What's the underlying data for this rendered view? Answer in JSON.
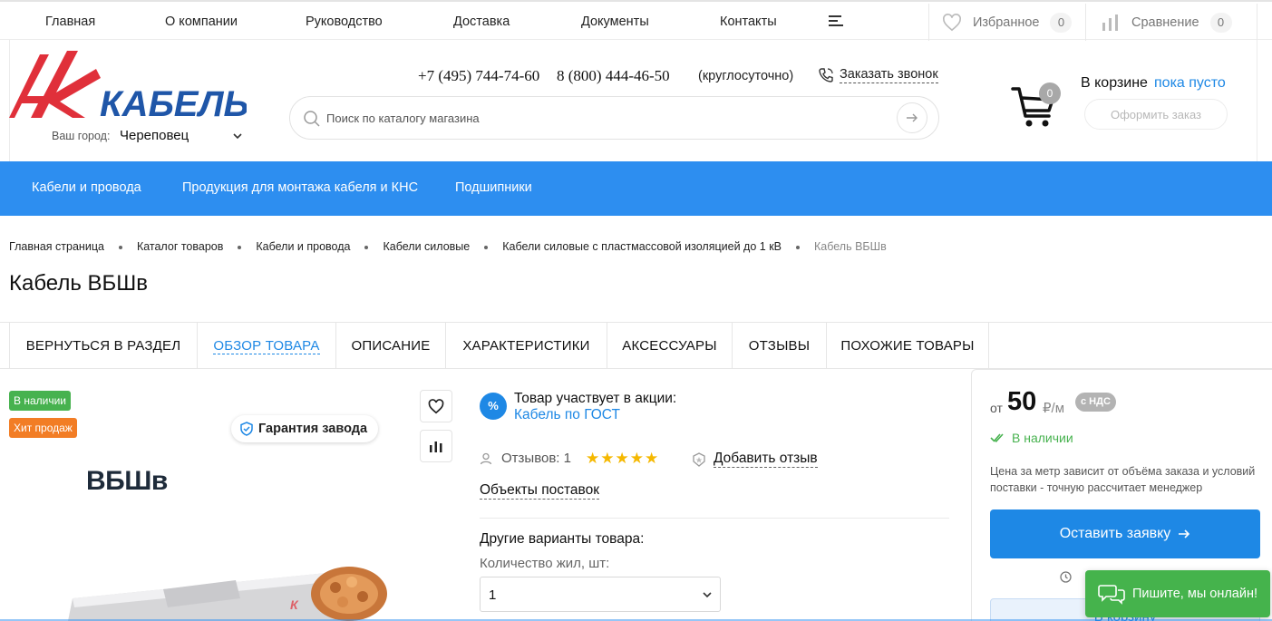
{
  "topnav": {
    "items": [
      "Главная",
      "О компании",
      "Руководство",
      "Доставка",
      "Документы",
      "Контакты"
    ],
    "favorites_label": "Избранное",
    "favorites_count": "0",
    "compare_label": "Сравнение",
    "compare_count": "0"
  },
  "header": {
    "logo_text": "КАБЕЛЬ",
    "city_label": "Ваш город:",
    "city_value": "Череповец",
    "phone1": "+7 (495) 744-74-60",
    "phone2": "8 (800) 444-46-50",
    "phone_note": "(круглосуточно)",
    "callback_label": "Заказать звонок",
    "search_placeholder": "Поиск по каталогу магазина",
    "cart_count": "0",
    "cart_label": "В корзине",
    "cart_status": "пока пусто",
    "checkout_label": "Оформить заказ"
  },
  "catalog_nav": {
    "items": [
      "Кабели и провода",
      "Продукция для монтажа кабеля и КНС",
      "Подшипники"
    ]
  },
  "breadcrumbs": [
    "Главная страница",
    "Каталог товаров",
    "Кабели и провода",
    "Кабели силовые",
    "Кабели силовые с пластмассовой изоляцией до 1 кВ",
    "Кабель ВБШв"
  ],
  "page_title": "Кабель ВБШв",
  "tabs": [
    "ВЕРНУТЬСЯ В РАЗДЕЛ",
    "ОБЗОР ТОВАРА",
    "ОПИСАНИЕ",
    "ХАРАКТЕРИСТИКИ",
    "АКСЕССУАРЫ",
    "ОТЗЫВЫ",
    "ПОХОЖИЕ ТОВАРЫ"
  ],
  "product": {
    "badge_stock": "В наличии",
    "badge_hit": "Хит продаж",
    "guarantee": "Гарантия завода",
    "image_label": "ВБШв",
    "promo_icon": "%",
    "promo_title": "Товар участвует в акции:",
    "promo_link": "Кабель по ГОСТ",
    "reviews_label": "Отзывов: 1",
    "rating_stars": 5,
    "add_review": "Добавить отзыв",
    "supply_objects": "Объекты поставок",
    "variants_title": "Другие варианты товара:",
    "cores_label": "Количество жил, шт:",
    "cores_value": "1"
  },
  "price_panel": {
    "from": "от",
    "price": "50",
    "unit": "₽/м",
    "vat": "с НДС",
    "stock": "В наличии",
    "note": "Цена за метр зависит от объёма заказа и условий поставки - точную рассчитает менеджер",
    "request_label": "Оставить заявку",
    "tocart_label": "В корзину"
  },
  "chat": {
    "label": "Пишите, мы онлайн!"
  },
  "colors": {
    "brand_blue": "#2d8ef0",
    "link_blue": "#1e88e5",
    "logo_red": "#e0303a",
    "stock_green": "#47b24f",
    "hit_orange": "#f27d25"
  }
}
